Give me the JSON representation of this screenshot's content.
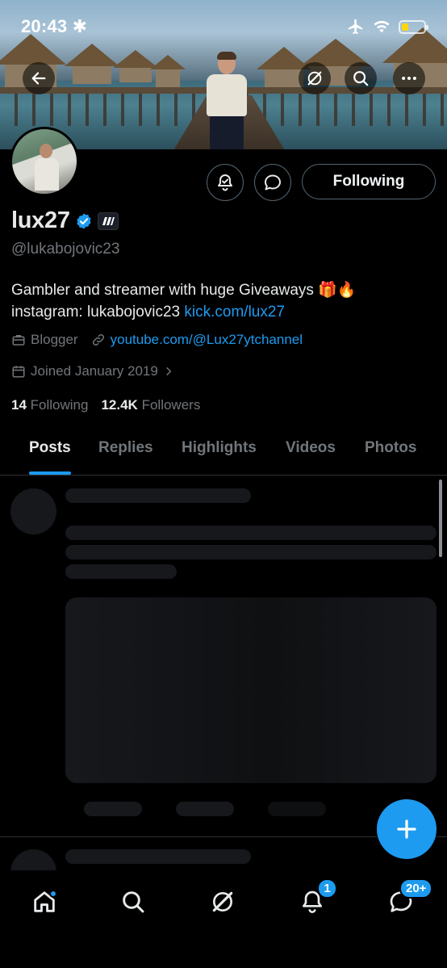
{
  "status_bar": {
    "time": "20:43"
  },
  "profile": {
    "display_name": "lux27",
    "handle": "@lukabojovic23",
    "bio_line1": "Gambler and streamer with huge Giveaways 🎁🔥",
    "bio_line2_prefix": "instagram: lukabojovic23 ",
    "bio_link": "kick.com/lux27",
    "category": "Blogger",
    "website": "youtube.com/@Lux27ytchannel",
    "joined": "Joined January 2019",
    "following_count": "14",
    "following_label": "Following",
    "followers_count": "12.4K",
    "followers_label": "Followers"
  },
  "actions": {
    "follow_button_label": "Following"
  },
  "tabs": [
    {
      "label": "Posts",
      "active": true
    },
    {
      "label": "Replies",
      "active": false
    },
    {
      "label": "Highlights",
      "active": false
    },
    {
      "label": "Videos",
      "active": false
    },
    {
      "label": "Photos",
      "active": false
    }
  ],
  "bottom_nav": {
    "notifications_badge": "1",
    "messages_badge": "20+"
  },
  "colors": {
    "accent": "#1d9bf0",
    "background": "#000000",
    "text_primary": "#e7e9ea",
    "text_secondary": "#71767b",
    "battery": "#ffd60a"
  },
  "icons": [
    "back-arrow-icon",
    "grok-icon",
    "search-icon",
    "more-icon",
    "notification-bell-add-icon",
    "message-icon",
    "verified-badge-icon",
    "affiliate-badge-icon",
    "briefcase-icon",
    "link-icon",
    "calendar-icon",
    "chevron-right-icon",
    "compose-plus-icon",
    "home-icon",
    "explore-icon",
    "bell-icon",
    "messages-icon",
    "airplane-icon",
    "wifi-icon",
    "battery-icon"
  ]
}
